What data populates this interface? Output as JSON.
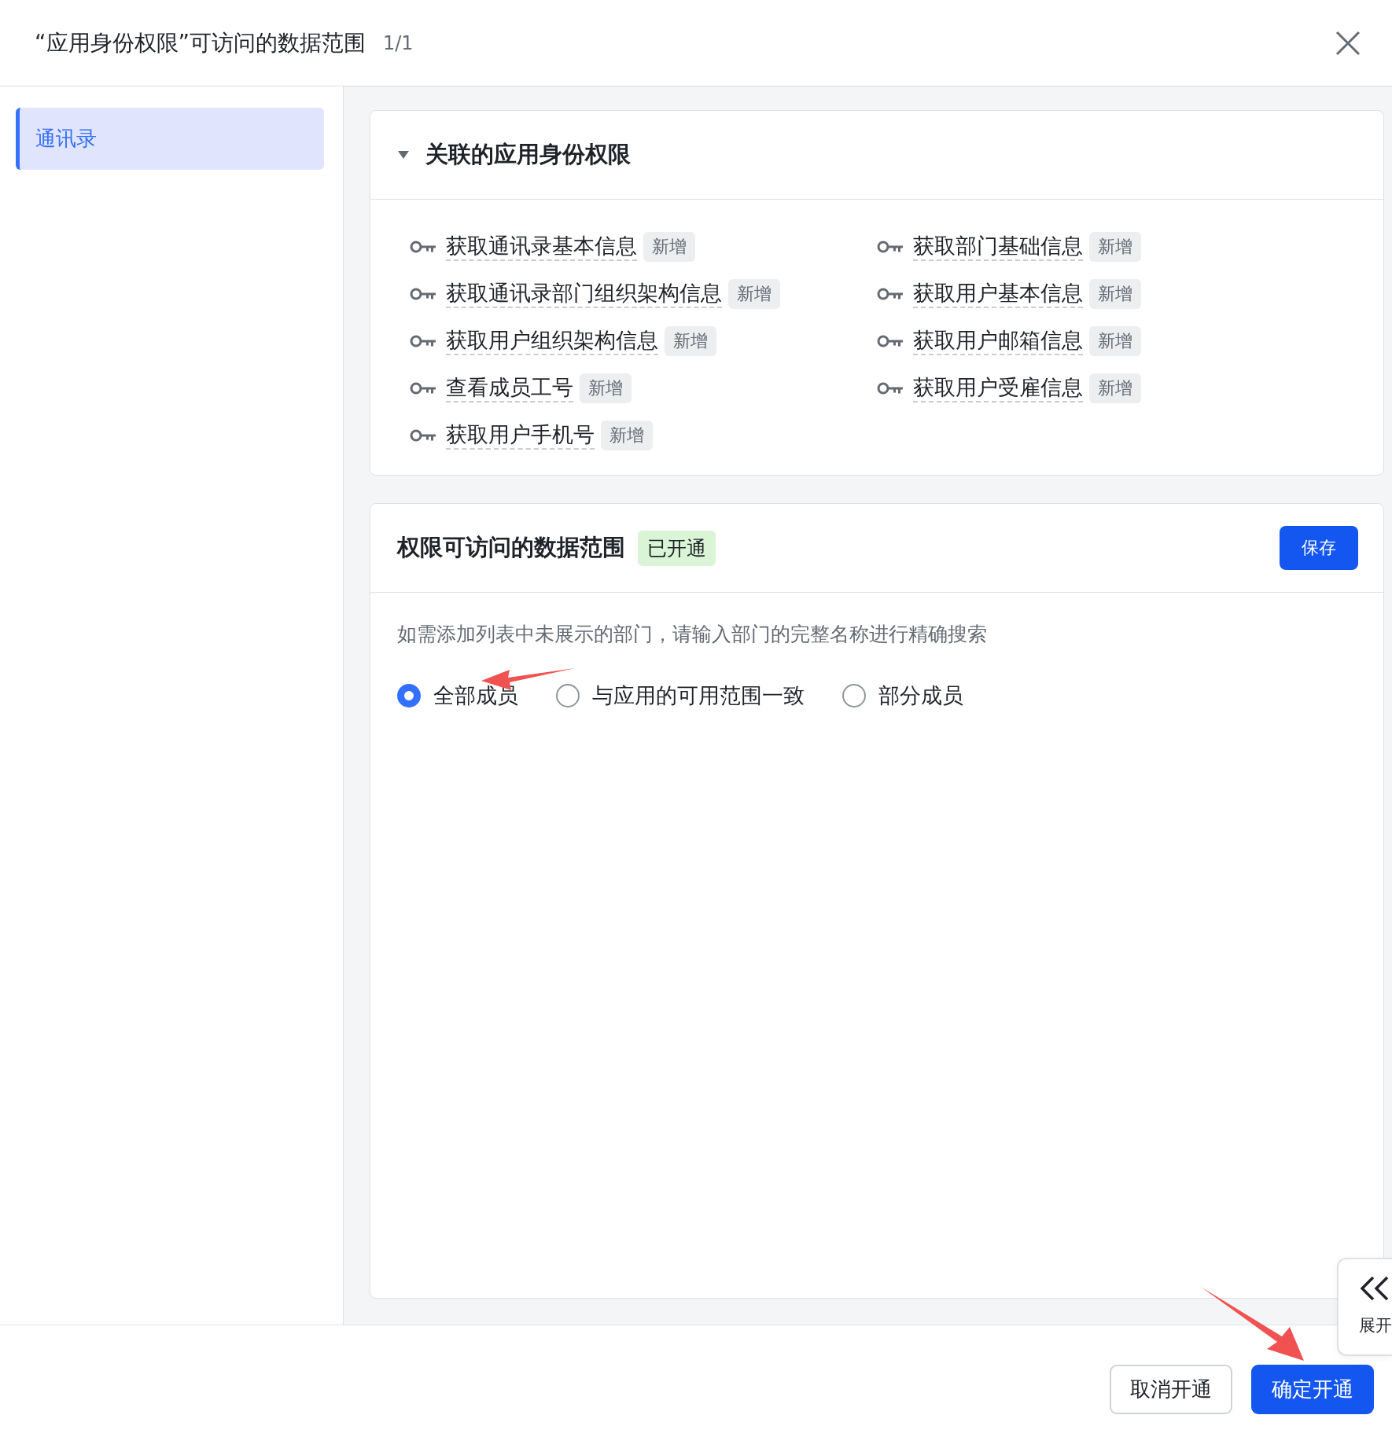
{
  "dialog": {
    "title": "“应用身份权限”可访问的数据范围",
    "counter": "1/1"
  },
  "sidebar": {
    "items": [
      {
        "label": "通讯录",
        "selected": true
      }
    ]
  },
  "permissions_card": {
    "title": "关联的应用身份权限",
    "expanded": true,
    "items": [
      {
        "name": "获取通讯录基本信息",
        "tag": "新增"
      },
      {
        "name": "获取部门基础信息",
        "tag": "新增"
      },
      {
        "name": "获取通讯录部门组织架构信息",
        "tag": "新增"
      },
      {
        "name": "获取用户基本信息",
        "tag": "新增"
      },
      {
        "name": "获取用户组织架构信息",
        "tag": "新增"
      },
      {
        "name": "获取用户邮箱信息",
        "tag": "新增"
      },
      {
        "name": "查看成员工号",
        "tag": "新增"
      },
      {
        "name": "获取用户受雇信息",
        "tag": "新增"
      },
      {
        "name": "获取用户手机号",
        "tag": "新增"
      }
    ]
  },
  "scope_card": {
    "title": "权限可访问的数据范围",
    "status": "已开通",
    "save_button": "保存",
    "hint": "如需添加列表中未展示的部门，请输入部门的完整名称进行精确搜索",
    "options": [
      {
        "label": "全部成员",
        "selected": true
      },
      {
        "label": "与应用的可用范围一致",
        "selected": false
      },
      {
        "label": "部分成员",
        "selected": false
      }
    ]
  },
  "expand_tab": {
    "label": "展开"
  },
  "footer": {
    "buttons": [
      {
        "label": "取消开通",
        "kind": "secondary"
      },
      {
        "label": "确定开通",
        "kind": "primary"
      }
    ]
  }
}
